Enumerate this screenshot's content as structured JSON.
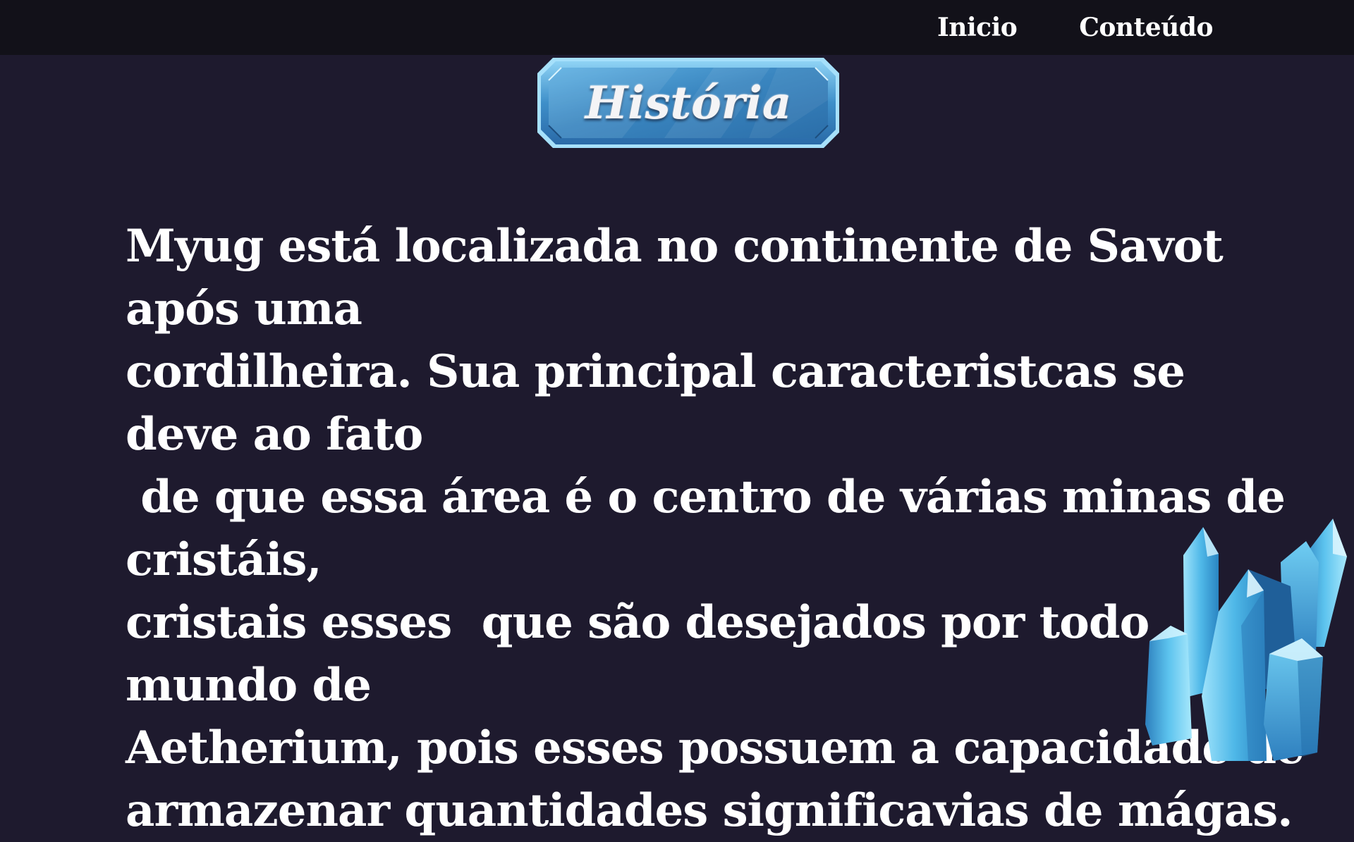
{
  "nav": {
    "items": [
      {
        "label": "Inicio"
      },
      {
        "label": "Conteúdo"
      }
    ]
  },
  "banner": {
    "title": "História"
  },
  "story": {
    "lines": [
      "Myug está localizada no continente de Savot após uma",
      "cordilheira. Sua principal caracteristcas se deve ao fato",
      " de que essa área é o centro de várias minas de cristáis,",
      "cristais esses  que são desejados por todo mundo de",
      "Aetherium, pois esses possuem a capacidade de",
      "armazenar quantidades significavias de mágas."
    ]
  },
  "colors": {
    "page_background": "#1e1a2e",
    "topbar_background": "#121119",
    "banner_blue": "#3e8fc9",
    "crystal_blue": "#4fb8e8"
  },
  "icons": {
    "decoration": "crystal-cluster-icon"
  }
}
